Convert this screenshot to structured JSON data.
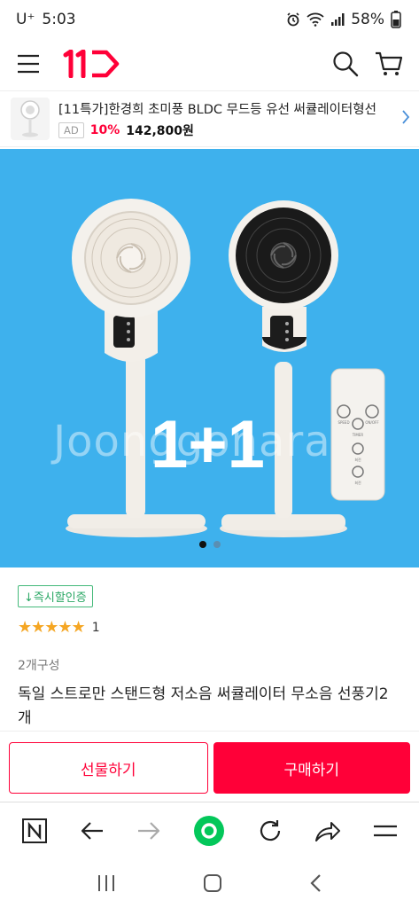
{
  "status": {
    "carrier": "U⁺",
    "time": "5:03",
    "battery": "58%"
  },
  "header": {
    "logo_text": "11",
    "brand_color": "#ff0038"
  },
  "ad": {
    "title": "[11특가]한경희 초미풍 BLDC 무드등 유선 써큘레이터형선",
    "badge": "AD",
    "discount": "10%",
    "price": "142,800원"
  },
  "hero": {
    "promo_text": "1+1",
    "watermark": "Joonggonara",
    "background_color": "#3eb1ed",
    "slide_count": 2,
    "active_slide": 1
  },
  "product": {
    "cert_badge": "↓즉시할인증",
    "stars": "★★★★★",
    "rating_count": "1",
    "option_label": "2개구성",
    "title": "독일 스트로만 스탠드형 저소음 써큘레이터 무소음 선풍기2개"
  },
  "actions": {
    "gift_label": "선물하기",
    "buy_label": "구매하기"
  },
  "remote_labels": {
    "speed": "SPEED",
    "onoff": "ON/OFF",
    "timer": "TIMER",
    "mode1": "회전",
    "mode2": "회전"
  }
}
